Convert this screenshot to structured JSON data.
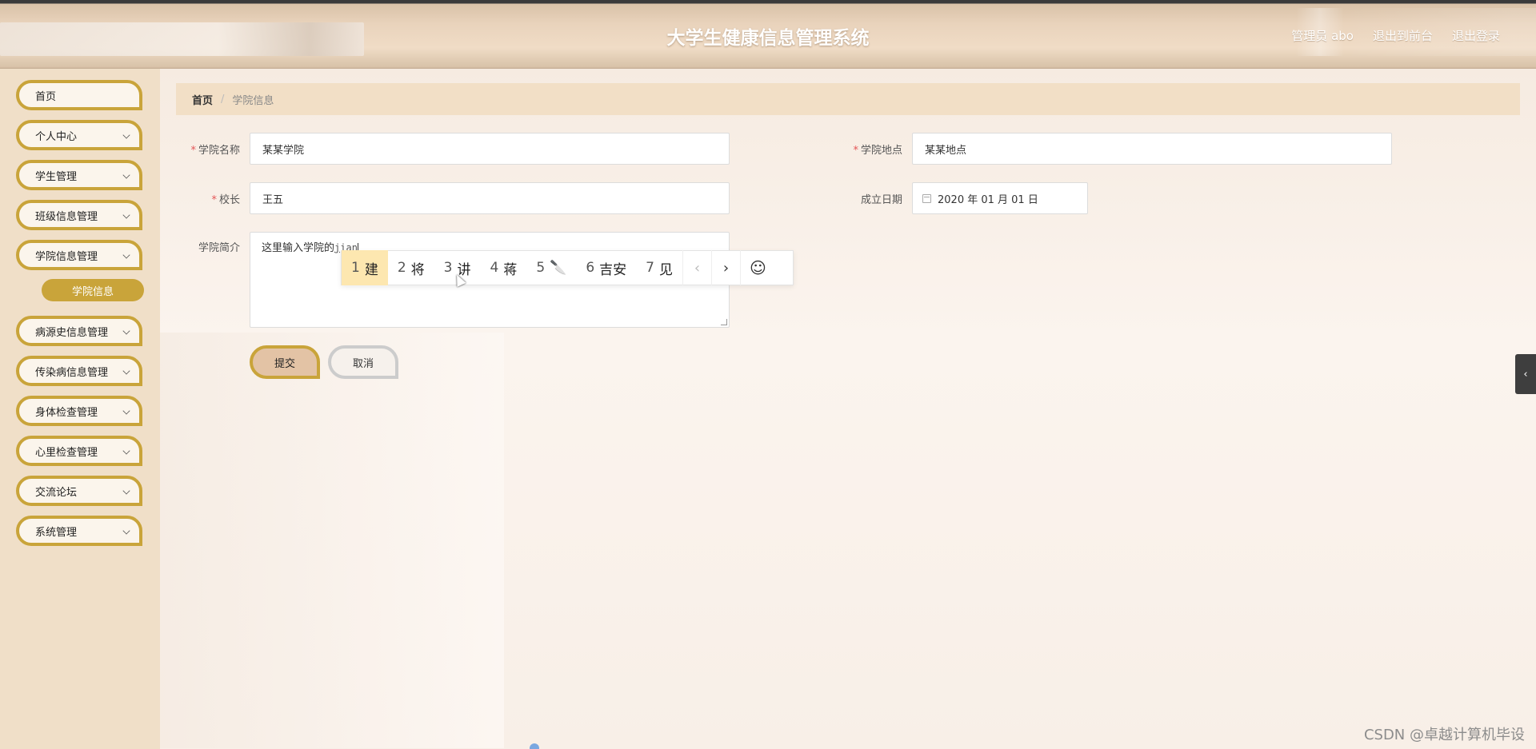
{
  "header": {
    "title": "大学生健康信息管理系统",
    "links": [
      "管理员 abo",
      "退出到前台",
      "退出登录"
    ]
  },
  "sidebar": {
    "items": [
      {
        "label": "首页",
        "expandable": false
      },
      {
        "label": "个人中心",
        "expandable": true
      },
      {
        "label": "学生管理",
        "expandable": true
      },
      {
        "label": "班级信息管理",
        "expandable": true
      },
      {
        "label": "学院信息管理",
        "expandable": true
      },
      {
        "label": "病源史信息管理",
        "expandable": true
      },
      {
        "label": "传染病信息管理",
        "expandable": true
      },
      {
        "label": "身体检查管理",
        "expandable": true
      },
      {
        "label": "心里检查管理",
        "expandable": true
      },
      {
        "label": "交流论坛",
        "expandable": true
      },
      {
        "label": "系统管理",
        "expandable": true
      }
    ],
    "active_sub": "学院信息"
  },
  "breadcrumb": {
    "home": "首页",
    "separator": "/",
    "current": "学院信息"
  },
  "form": {
    "college_name": {
      "label": "学院名称",
      "value": "某某学院",
      "required": true
    },
    "college_location": {
      "label": "学院地点",
      "value": "某某地点",
      "required": true
    },
    "principal": {
      "label": "校长",
      "value": "王五",
      "required": true
    },
    "founded_date": {
      "label": "成立日期",
      "value": "2020 年 01 月 01 日",
      "required": false
    },
    "intro": {
      "label": "学院简介",
      "value": "这里输入学院的",
      "composing": "jian",
      "required": false
    }
  },
  "ime": {
    "candidates": [
      {
        "n": "1",
        "text": "建"
      },
      {
        "n": "2",
        "text": "将"
      },
      {
        "n": "3",
        "text": "讲"
      },
      {
        "n": "4",
        "text": "蒋"
      },
      {
        "n": "5",
        "text": "🔪"
      },
      {
        "n": "6",
        "text": "吉安"
      },
      {
        "n": "7",
        "text": "见"
      }
    ],
    "prev": "‹",
    "next": "›",
    "emoji": "☺"
  },
  "buttons": {
    "submit": "提交",
    "cancel": "取消"
  },
  "side_toggle": "‹",
  "watermark": "CSDN @卓越计算机毕设",
  "colors": {
    "accent": "#c9a43a",
    "required": "#e45656",
    "ime_selected": "#fde7b0"
  }
}
